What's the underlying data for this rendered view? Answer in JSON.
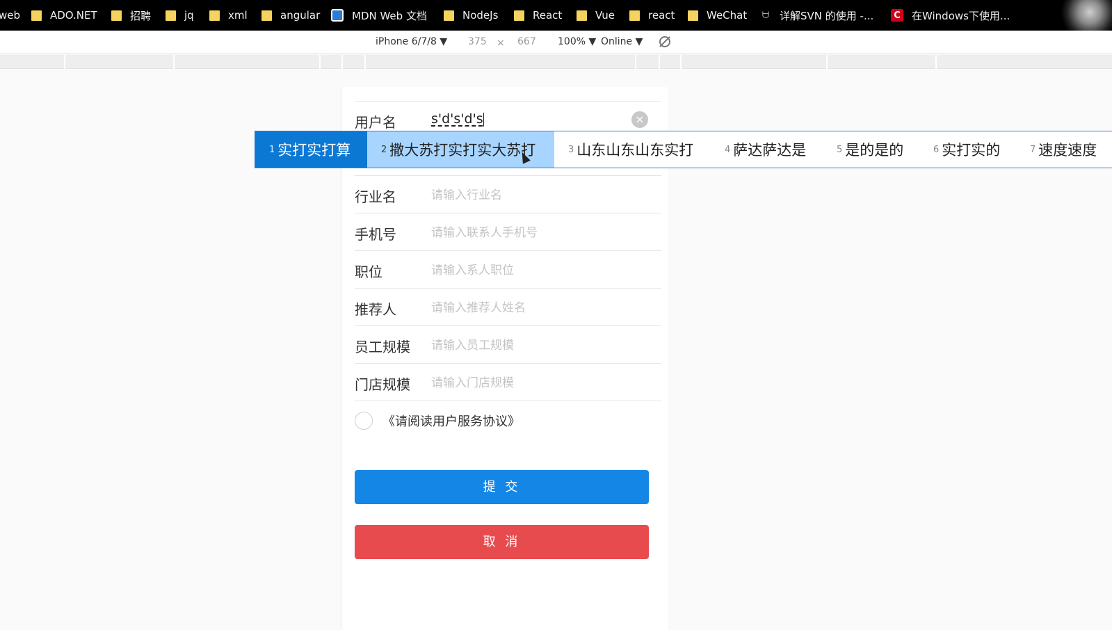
{
  "bookmarks": [
    {
      "label": "web",
      "icon": "folder-icon"
    },
    {
      "label": "ADO.NET",
      "icon": "folder-icon"
    },
    {
      "label": "招聘",
      "icon": "folder-icon"
    },
    {
      "label": "jq",
      "icon": "folder-icon"
    },
    {
      "label": "xml",
      "icon": "folder-icon"
    },
    {
      "label": "angular",
      "icon": "folder-icon"
    },
    {
      "label": "MDN Web 文档",
      "icon": "mdn-icon"
    },
    {
      "label": "NodeJs",
      "icon": "folder-icon"
    },
    {
      "label": "React",
      "icon": "folder-icon"
    },
    {
      "label": "Vue",
      "icon": "folder-icon"
    },
    {
      "label": "react",
      "icon": "folder-icon"
    },
    {
      "label": "WeChat",
      "icon": "folder-icon"
    },
    {
      "label": "详解SVN 的使用 -...",
      "icon": "svn-icon"
    },
    {
      "label": "在Windows下使用...",
      "icon": "csdn-icon"
    }
  ],
  "device_toolbar": {
    "device": "iPhone 6/7/8 ▼",
    "width": "375",
    "times": "×",
    "height": "667",
    "zoom": "100% ▼",
    "network": "Online ▼"
  },
  "form": {
    "username": {
      "label": "用户名",
      "value": "s'd's'd's",
      "clear_icon": "×"
    },
    "industry": {
      "label": "行业名",
      "placeholder": "请输入行业名"
    },
    "phone": {
      "label": "手机号",
      "placeholder": "请输入联系人手机号"
    },
    "position": {
      "label": "职位",
      "placeholder": "请输入系人职位"
    },
    "referrer": {
      "label": "推荐人",
      "placeholder": "请输入推荐人姓名"
    },
    "staff_size": {
      "label": "员工规模",
      "placeholder": "请输入员工规模"
    },
    "store_size": {
      "label": "门店规模",
      "placeholder": "请输入门店规模"
    },
    "agreement": "《请阅读用户服务协议》",
    "submit": "提 交",
    "cancel": "取 消"
  },
  "ime": {
    "candidates": [
      {
        "num": "1",
        "text": "实打实打算"
      },
      {
        "num": "2",
        "text": "撒大苏打实打实大苏打"
      },
      {
        "num": "3",
        "text": "山东山东山东实打"
      },
      {
        "num": "4",
        "text": "萨达萨达是"
      },
      {
        "num": "5",
        "text": "是的是的"
      },
      {
        "num": "6",
        "text": "实打实的"
      },
      {
        "num": "7",
        "text": "速度速度"
      }
    ],
    "selected_index": 1,
    "hover_index": 2
  },
  "colors": {
    "submit": "#1487e6",
    "cancel": "#e84b4e",
    "ime_selected": "#0b78d4",
    "ime_hover": "#a8d5ff"
  }
}
